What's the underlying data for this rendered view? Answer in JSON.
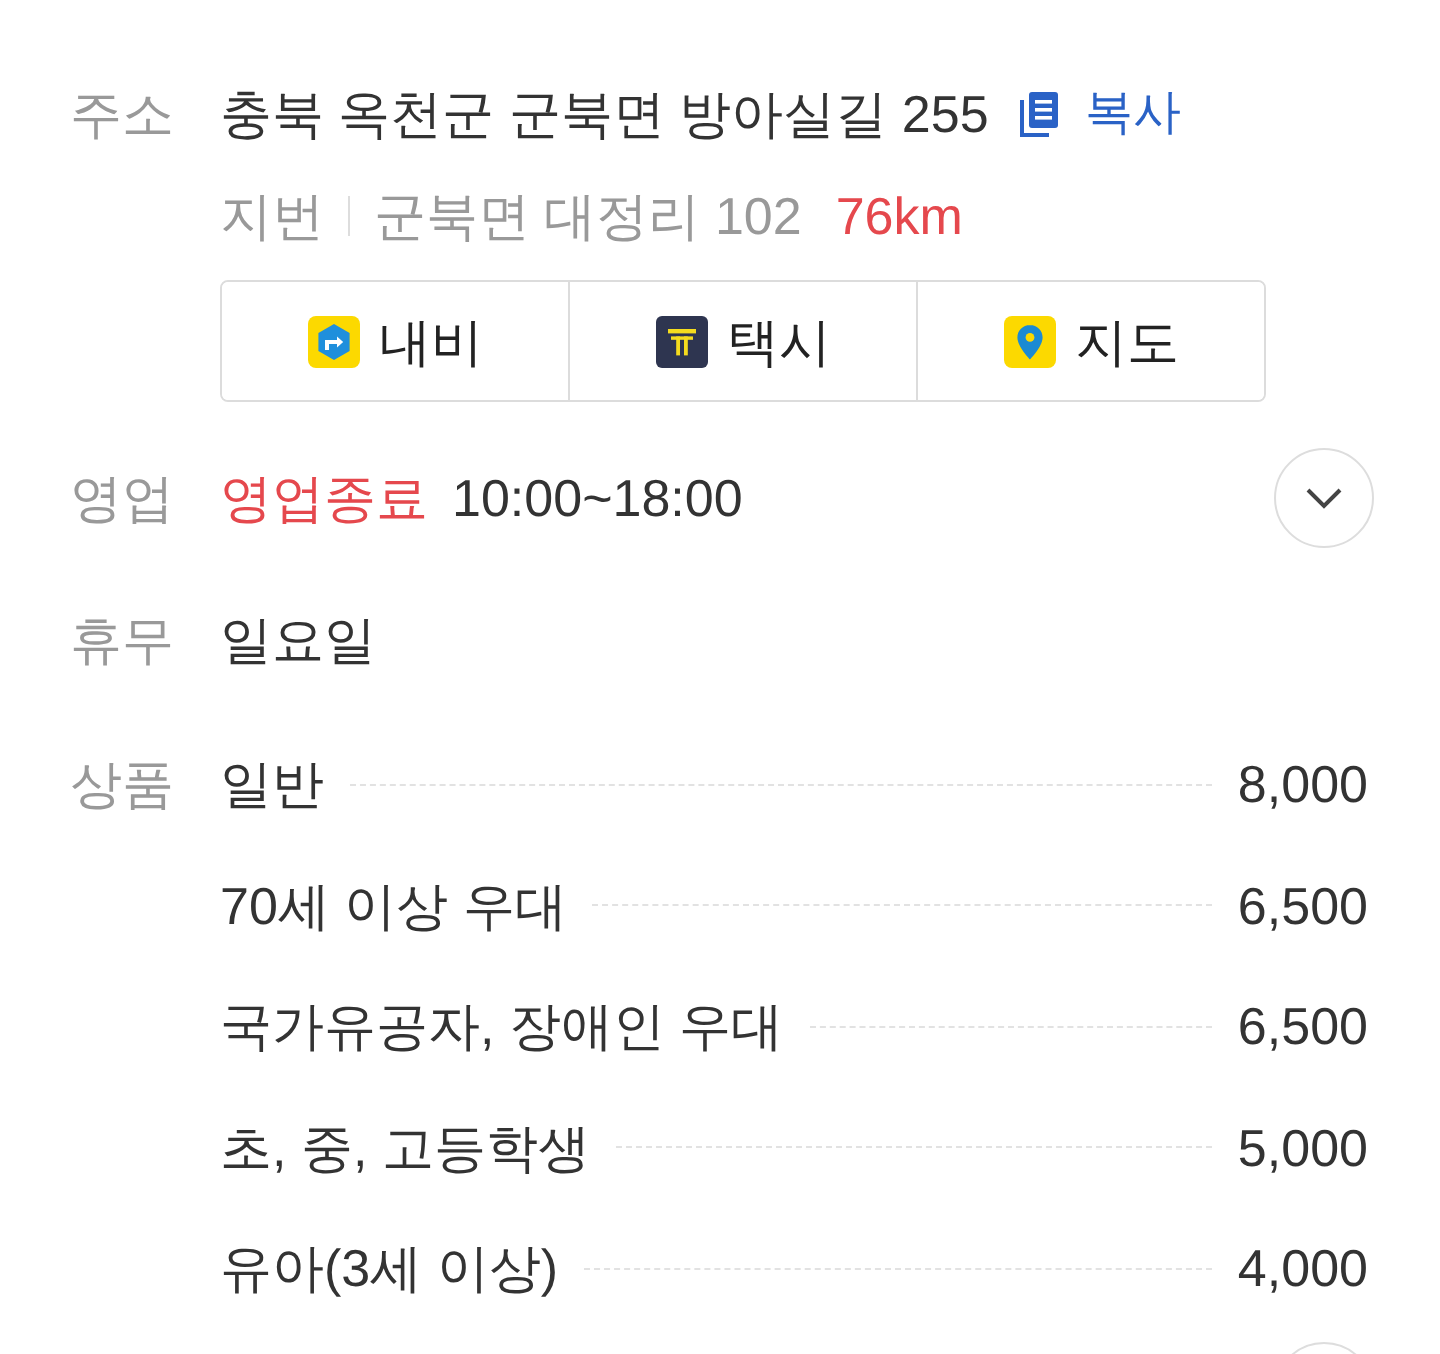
{
  "address": {
    "label": "주소",
    "road": "충북 옥천군 군북면 방아실길 255",
    "copy": "복사",
    "lot_label": "지번",
    "lot": "군북면 대정리 102",
    "distance": "76km"
  },
  "actions": [
    {
      "kind": "navi",
      "label": "내비"
    },
    {
      "kind": "taxi",
      "label": "택시"
    },
    {
      "kind": "map",
      "label": "지도"
    }
  ],
  "hours": {
    "label": "영업",
    "status": "영업종료",
    "time": "10:00~18:00",
    "expanded": false
  },
  "closed": {
    "label": "휴무",
    "value": "일요일"
  },
  "prices": {
    "label": "상품",
    "items": [
      {
        "name": "일반",
        "price": "8,000"
      },
      {
        "name": "70세 이상 우대",
        "price": "6,500"
      },
      {
        "name": "국가유공자, 장애인 우대",
        "price": "6,500"
      },
      {
        "name": "초, 중, 고등학생",
        "price": "5,000"
      },
      {
        "name": "유아(3세 이상)",
        "price": "4,000"
      }
    ]
  }
}
